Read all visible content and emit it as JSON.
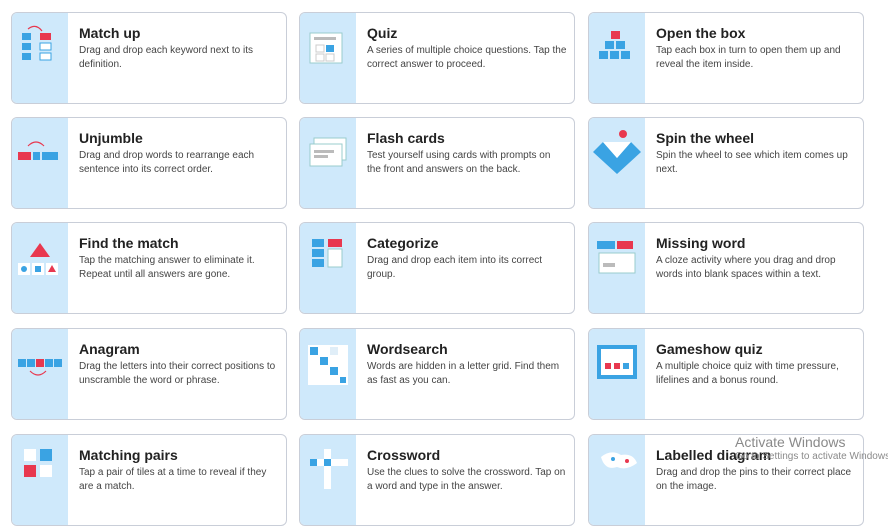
{
  "templates": [
    {
      "title": "Match up",
      "description": "Drag and drop each keyword next to its definition.",
      "icon": "match-up-icon"
    },
    {
      "title": "Quiz",
      "description": "A series of multiple choice questions. Tap the correct answer to proceed.",
      "icon": "quiz-icon"
    },
    {
      "title": "Open the box",
      "description": "Tap each box in turn to open them up and reveal the item inside.",
      "icon": "open-the-box-icon"
    },
    {
      "title": "Unjumble",
      "description": "Drag and drop words to rearrange each sentence into its correct order.",
      "icon": "unjumble-icon"
    },
    {
      "title": "Flash cards",
      "description": "Test yourself using cards with prompts on the front and answers on the back.",
      "icon": "flash-cards-icon"
    },
    {
      "title": "Spin the wheel",
      "description": "Spin the wheel to see which item comes up next.",
      "icon": "spin-the-wheel-icon"
    },
    {
      "title": "Find the match",
      "description": "Tap the matching answer to eliminate it. Repeat until all answers are gone.",
      "icon": "find-the-match-icon"
    },
    {
      "title": "Categorize",
      "description": "Drag and drop each item into its correct group.",
      "icon": "categorize-icon"
    },
    {
      "title": "Missing word",
      "description": "A cloze activity where you drag and drop words into blank spaces within a text.",
      "icon": "missing-word-icon"
    },
    {
      "title": "Anagram",
      "description": "Drag the letters into their correct positions to unscramble the word or phrase.",
      "icon": "anagram-icon"
    },
    {
      "title": "Wordsearch",
      "description": "Words are hidden in a letter grid. Find them as fast as you can.",
      "icon": "wordsearch-icon"
    },
    {
      "title": "Gameshow quiz",
      "description": "A multiple choice quiz with time pressure, lifelines and a bonus round.",
      "icon": "gameshow-quiz-icon"
    },
    {
      "title": "Matching pairs",
      "description": "Tap a pair of tiles at a time to reveal if they are a match.",
      "icon": "matching-pairs-icon"
    },
    {
      "title": "Crossword",
      "description": "Use the clues to solve the crossword. Tap on a word and type in the answer.",
      "icon": "crossword-icon"
    },
    {
      "title": "Labelled diagram",
      "description": "Drag and drop the pins to their correct place on the image.",
      "icon": "labelled-diagram-icon"
    }
  ],
  "watermark": {
    "line1": "Activate Windows",
    "line2": "Go to Settings to activate Windows."
  },
  "colors": {
    "thumb_bg": "#cfe9fb",
    "accent_blue": "#3aa3e3",
    "accent_red": "#e8384f"
  }
}
